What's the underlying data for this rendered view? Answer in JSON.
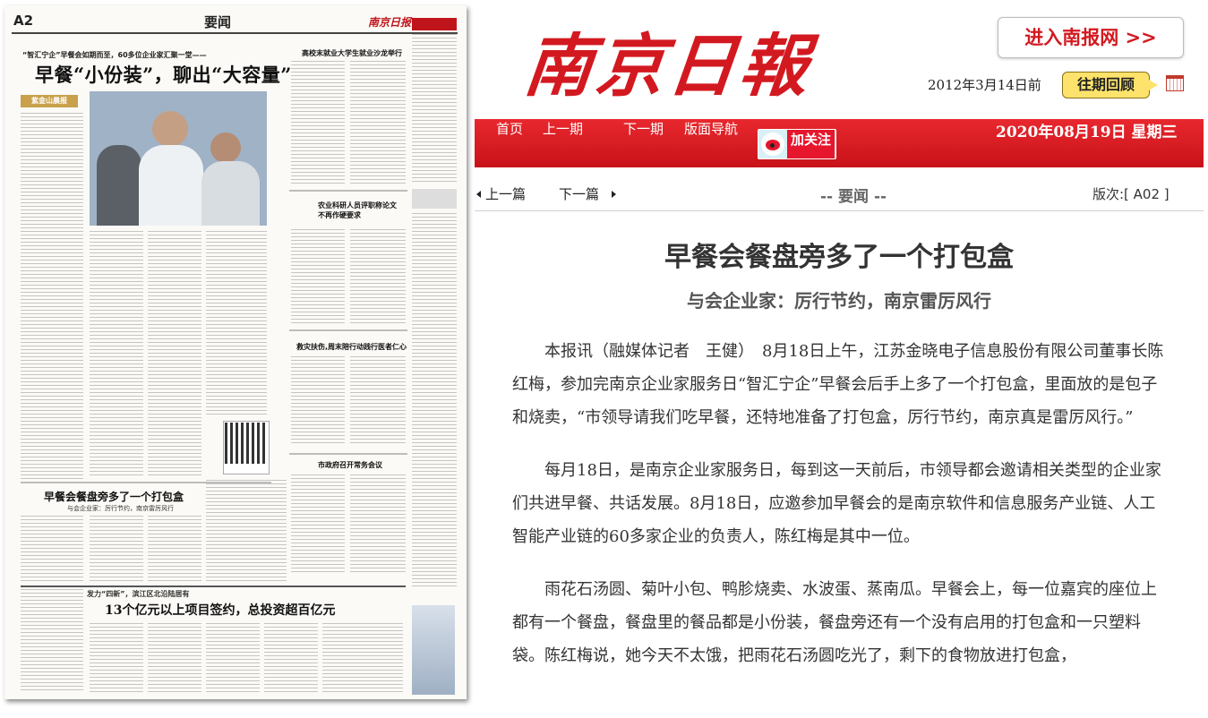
{
  "newspaper_page": {
    "page_number": "A2",
    "section": "要闻",
    "mini_logo": "南京日报",
    "lead_kicker": "“智汇宁企”早餐会如期而至，60多位企业家汇聚一堂——",
    "lead_headline": "早餐“小份装”，聊出“大容量”",
    "sponsor_logo": "紫金山晨报",
    "story2_headline": "高校末就业大学生就业沙龙举行",
    "story3_headline": "农业科研人员评职称论文不再作硬要求",
    "story4_headline": "救灾扶伤,周末陪行动践行医者仁心",
    "story5_headline": "市政府召开常务会议",
    "article_headline": "早餐会餐盘旁多了一个打包盒",
    "article_subheadline": "与会企业家：厉行节约，南京雷厉风行",
    "bottom_kicker": "发力“四新”，滨江区北沿陆居有",
    "bottom_headline": "13个亿元以上项目签约，总投资超百亿元"
  },
  "header": {
    "masthead": "南京日報",
    "enter_button": "进入南报网 >>",
    "history_date": "2012年3月14日前",
    "history_button": "往期回顾"
  },
  "navbar": {
    "items": [
      "首页",
      "上一期",
      "下一期",
      "版面导航"
    ],
    "weibo_label": "加关注",
    "today": "2020年08月19日  星期三"
  },
  "subbar": {
    "prev": "上一篇",
    "next": "下一篇",
    "section": "-- 要闻 --",
    "edition": "版次:[ A02 ]"
  },
  "article": {
    "title": "早餐会餐盘旁多了一个打包盒",
    "subtitle": "与会企业家：厉行节约，南京雷厉风行",
    "paragraphs": [
      "本报讯（融媒体记者　王健）　8月18日上午，江苏金晓电子信息股份有限公司董事长陈红梅，参加完南京企业家服务日“智汇宁企”早餐会后手上多了一个打包盒，里面放的是包子和烧卖，“市领导请我们吃早餐，还特地准备了打包盒，厉行节约，南京真是雷厉风行。”",
      "每月18日，是南京企业家服务日，每到这一天前后，市领导都会邀请相关类型的企业家们共进早餐、共话发展。8月18日，应邀参加早餐会的是南京软件和信息服务产业链、人工智能产业链的60多家企业的负责人，陈红梅是其中一位。",
      "雨花石汤圆、菊叶小包、鸭胗烧卖、水波蛋、蒸南瓜。早餐会上，每一位嘉宾的座位上都有一个餐盘，餐盘里的餐品都是小份装，餐盘旁还有一个没有启用的打包盒和一只塑料袋。陈红梅说，她今天不太饿，把雨花石汤圆吃光了，剩下的食物放进打包盒，"
    ]
  },
  "colors": {
    "brand_red": "#d31920",
    "nav_red": "#d8141c",
    "history_yellow": "#fde36b"
  }
}
